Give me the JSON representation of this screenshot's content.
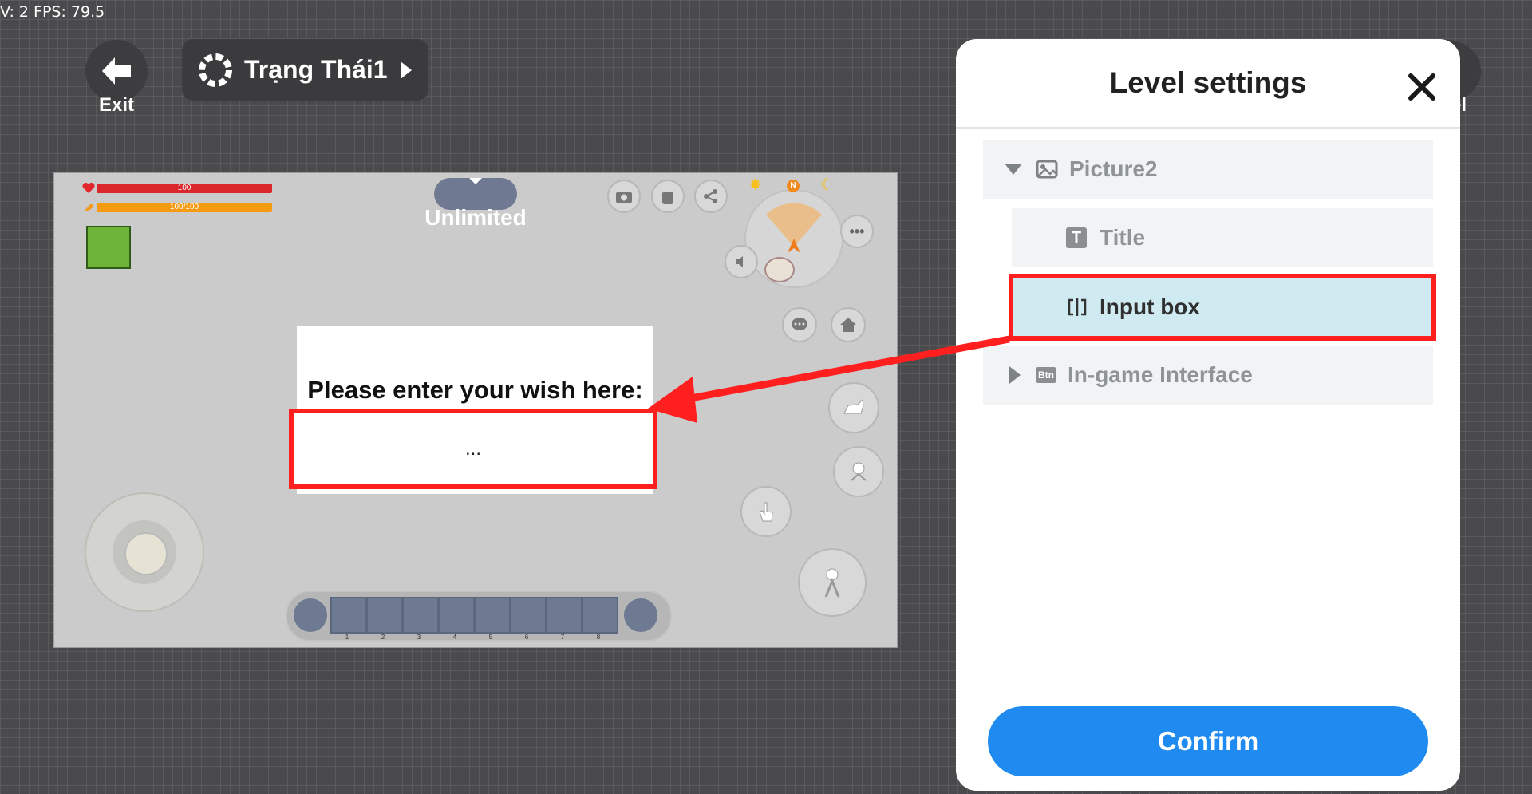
{
  "debug_overlay": "V: 2 FPS: 79.5",
  "toolbar": {
    "exit_label": "Exit",
    "state_label": "Trạng Thái1",
    "hidden_label": "el"
  },
  "game": {
    "hp_text": "100",
    "stamina_text": "100/100",
    "mode_label": "Unlimited",
    "compass_label": "N",
    "dialog_title": "Please enter your wish here:",
    "input_value": "...",
    "hotbar_slots": [
      "1",
      "2",
      "3",
      "4",
      "5",
      "6",
      "7",
      "8"
    ]
  },
  "panel": {
    "title": "Level settings",
    "tree": [
      {
        "label": "Picture2",
        "icon": "image-icon",
        "expanded": true
      },
      {
        "label": "Title",
        "icon": "text-icon"
      },
      {
        "label": "Input box",
        "icon": "input-box-icon",
        "selected": true
      },
      {
        "label": "In-game Interface",
        "icon": "button-icon",
        "badge": "Btn",
        "expanded": false
      }
    ],
    "confirm_label": "Confirm"
  },
  "colors": {
    "accent": "#1f8bf0",
    "highlight": "#ff1f1f",
    "selected_row": "#cfeaf0"
  }
}
